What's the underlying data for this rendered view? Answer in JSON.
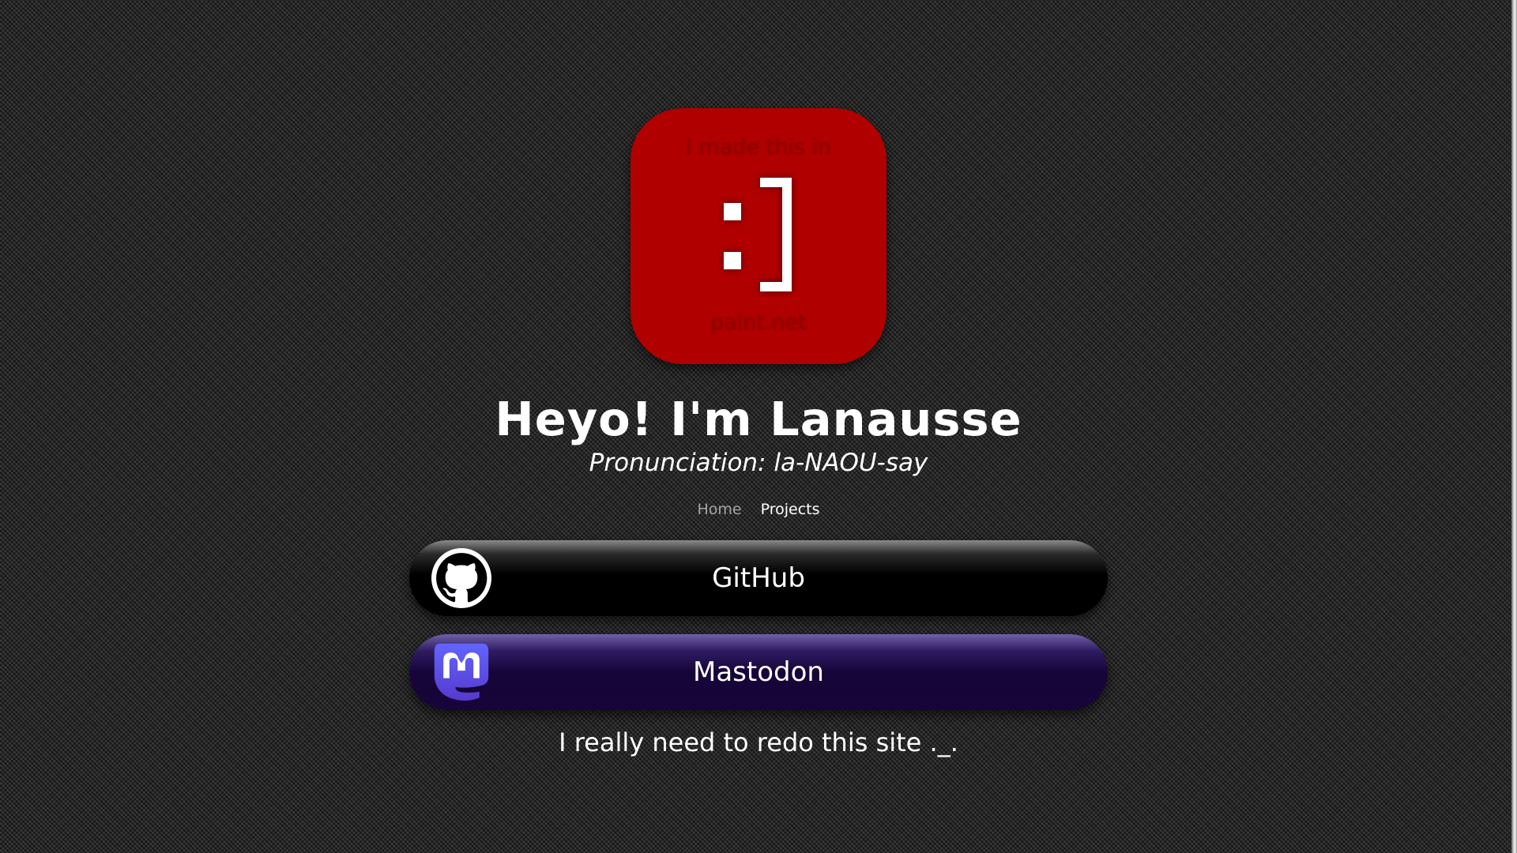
{
  "logo": {
    "top_text": "I made this in",
    "bottom_text": "paint.net",
    "face_icon": "smiley-face-icon",
    "color": "#b00000"
  },
  "header": {
    "title": "Heyo! I'm Lanausse",
    "subtitle": "Pronunciation: la-NAOU-say"
  },
  "nav": {
    "items": [
      {
        "label": "Home",
        "active": false
      },
      {
        "label": "Projects",
        "active": true
      }
    ]
  },
  "links": [
    {
      "label": "GitHub",
      "icon": "github-icon",
      "color": "#000000"
    },
    {
      "label": "Mastodon",
      "icon": "mastodon-icon",
      "color": "#170438"
    }
  ],
  "footer": {
    "text": "I really need to redo this site ._."
  }
}
